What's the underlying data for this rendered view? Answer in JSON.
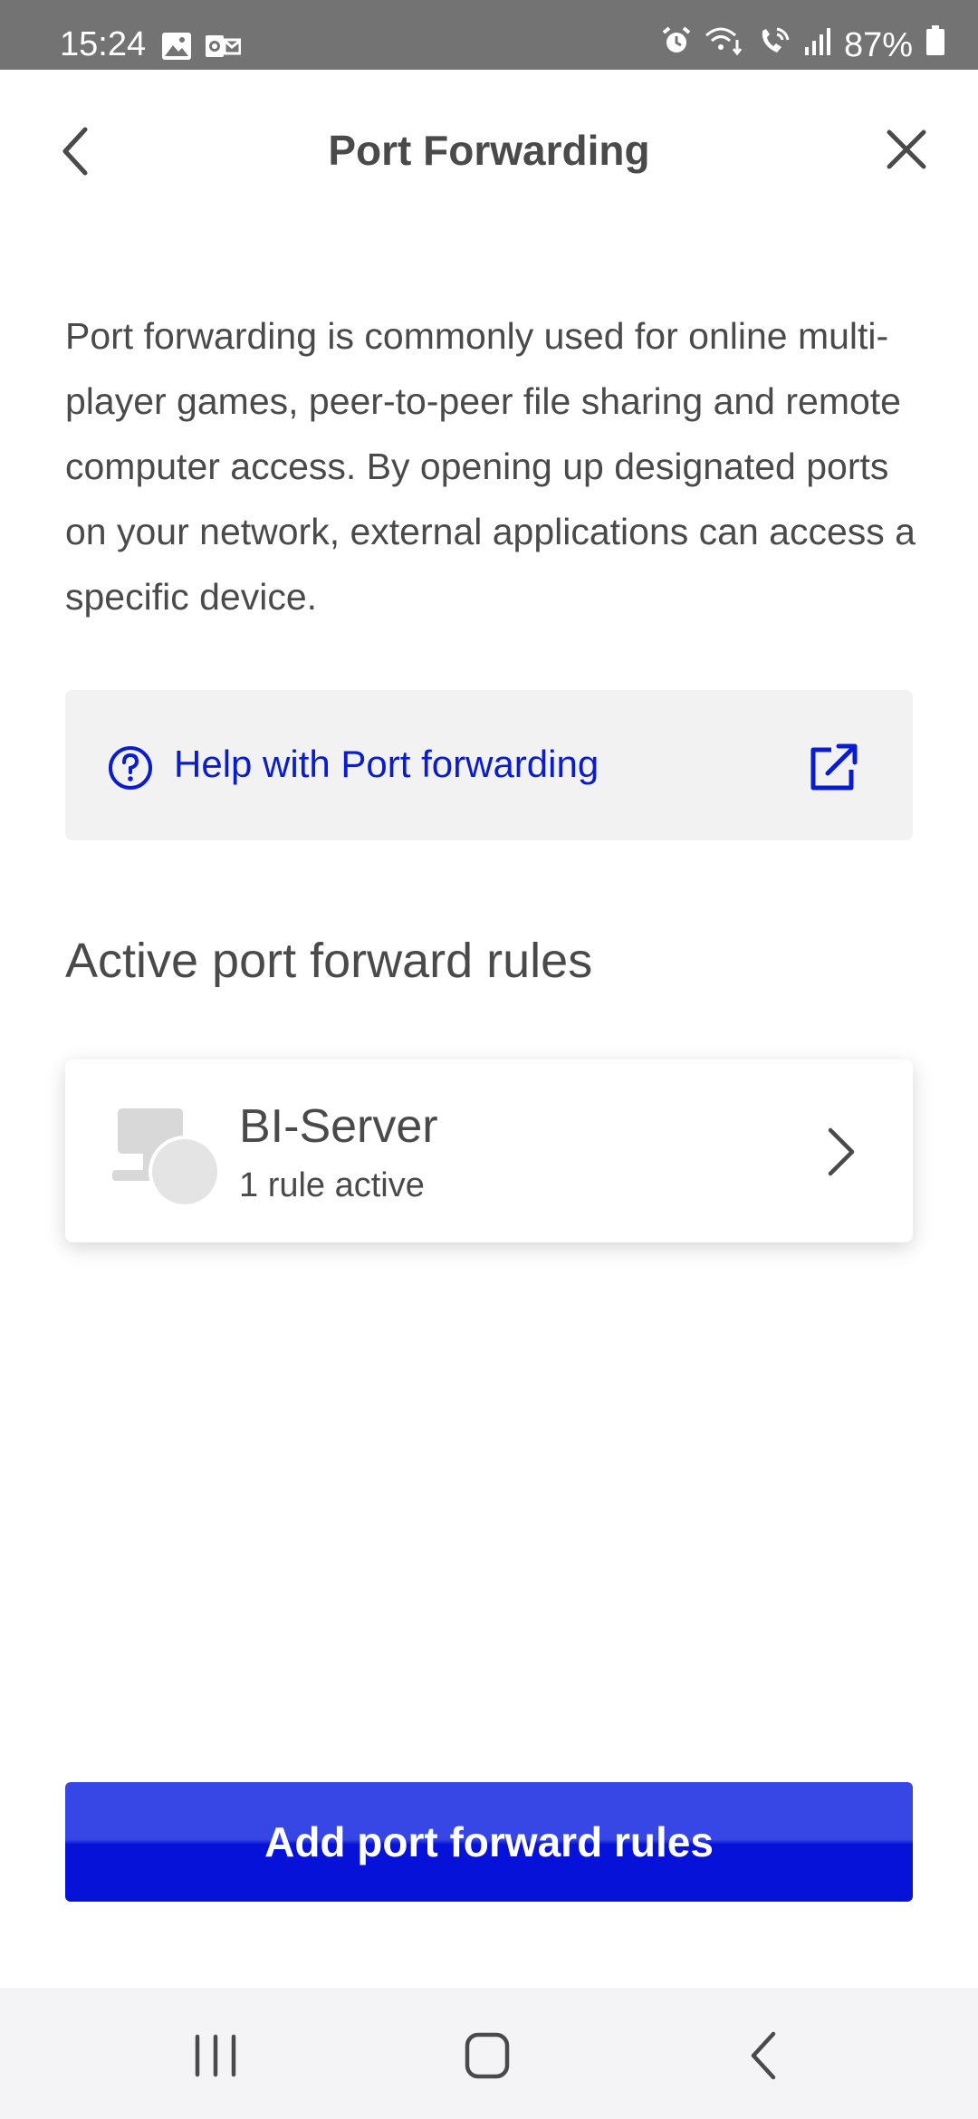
{
  "status_bar": {
    "time": "15:24",
    "battery_percent": "87%",
    "left_icons": [
      "gallery-icon",
      "outlook-icon"
    ],
    "right_icons": [
      "alarm-icon",
      "wifi-calling-icon",
      "volte-call-icon",
      "signal-icon",
      "battery-icon"
    ]
  },
  "header": {
    "title": "Port Forwarding"
  },
  "description": "Port forwarding is commonly used for online multi-player games, peer-to-peer file sharing and remote computer access. By opening up designated ports on your network, external applications can access a specific device.",
  "help": {
    "label": "Help with Port forwarding"
  },
  "rules_section": {
    "title": "Active port forward rules",
    "devices": [
      {
        "name": "BI-Server",
        "status": "1 rule active"
      }
    ]
  },
  "actions": {
    "add_label": "Add port forward rules"
  },
  "colors": {
    "accent_blue": "#0a1ccf",
    "button_blue": "#0712d8",
    "status_bar_bg": "#737373",
    "card_bg": "#f2f2f2"
  }
}
